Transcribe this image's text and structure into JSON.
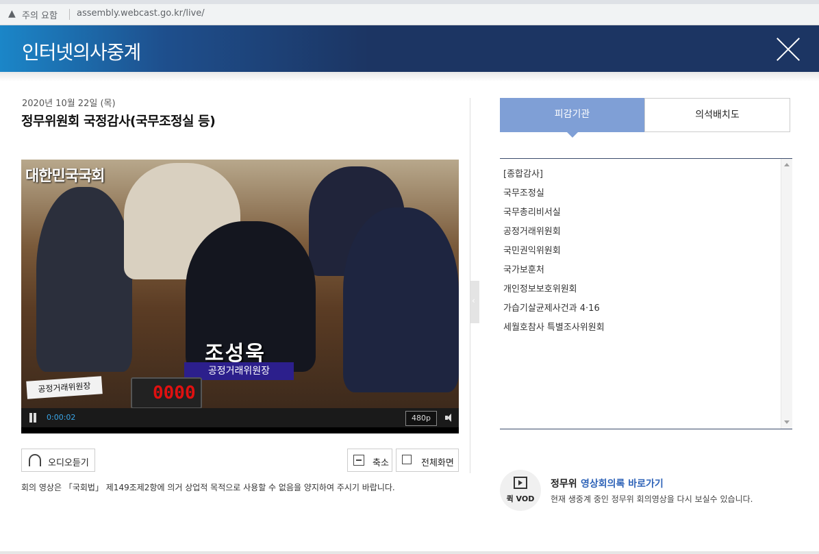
{
  "browser": {
    "security_label": "주의 요함",
    "url": "assembly.webcast.go.kr/live/"
  },
  "header": {
    "title": "인터넷의사중계"
  },
  "session": {
    "date": "2020년 10월 22일 (목)",
    "title": "정무위원회 국정감사(국무조정실 등)"
  },
  "video": {
    "watermark": "대한민국국회",
    "caption_name": "조성욱",
    "caption_role": "공정거래위원장",
    "nameplate": "공정거래위원장",
    "timer_display": "0000",
    "current_time": "0:00:02",
    "quality": "480p"
  },
  "buttons": {
    "audio": "오디오듣기",
    "zoom_out": "축소",
    "fullscreen": "전체화면"
  },
  "notice": "회의 영상은 「국회법」 제149조제2항에 의거 상업적 목적으로 사용할 수 없음을 양지하여 주시기 바랍니다.",
  "tabs": [
    {
      "label": "피감기관"
    },
    {
      "label": "의석배치도"
    }
  ],
  "agencies": [
    "[종합감사]",
    "국무조정실",
    "국무총리비서실",
    "공정거래위원회",
    "국민권익위원회",
    "국가보훈처",
    "개인정보보호위원회",
    "가습기살균제사건과 4·16",
    "세월호참사 특별조사위원회"
  ],
  "vod": {
    "badge": "퀵 VOD",
    "title_prefix": "정무위",
    "title_link": "영상회의록 바로가기",
    "description": "현재 생중계 중인 정무위 회의영상을 다시 보실수 있습니다."
  },
  "colors": {
    "header_dark": "#1c3563",
    "header_light": "#1b86c8",
    "tab_active": "#7f9fd6",
    "link_blue": "#2e63b8",
    "timer_red": "#e01010"
  },
  "icons": [
    "warning-icon",
    "close-icon",
    "pause-icon",
    "volume-icon",
    "headset-icon",
    "minus-icon",
    "fullscreen-icon",
    "film-icon",
    "scroll-up-icon",
    "scroll-down-icon"
  ]
}
